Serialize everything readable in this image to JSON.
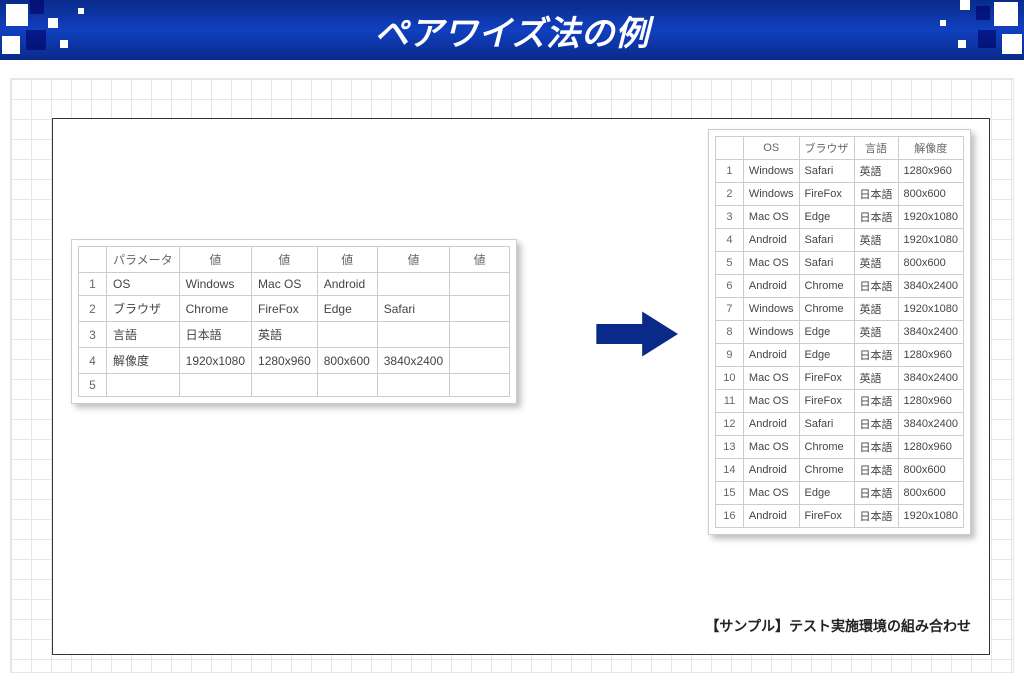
{
  "title": "ペアワイズ法の例",
  "caption": "【サンプル】テスト実施環境の組み合わせ",
  "input_table": {
    "headers": [
      "",
      "パラメータ",
      "値",
      "値",
      "値",
      "値",
      "値"
    ],
    "rows": [
      [
        "1",
        "OS",
        "Windows",
        "Mac OS",
        "Android",
        "",
        ""
      ],
      [
        "2",
        "ブラウザ",
        "Chrome",
        "FireFox",
        "Edge",
        "Safari",
        ""
      ],
      [
        "3",
        "言語",
        "日本語",
        "英語",
        "",
        "",
        ""
      ],
      [
        "4",
        "解像度",
        "1920x1080",
        "1280x960",
        "800x600",
        "3840x2400",
        ""
      ],
      [
        "5",
        "",
        "",
        "",
        "",
        "",
        ""
      ]
    ]
  },
  "output_table": {
    "headers": [
      "",
      "OS",
      "ブラウザ",
      "言語",
      "解像度"
    ],
    "rows": [
      [
        "1",
        "Windows",
        "Safari",
        "英語",
        "1280x960"
      ],
      [
        "2",
        "Windows",
        "FireFox",
        "日本語",
        "800x600"
      ],
      [
        "3",
        "Mac OS",
        "Edge",
        "日本語",
        "1920x1080"
      ],
      [
        "4",
        "Android",
        "Safari",
        "英語",
        "1920x1080"
      ],
      [
        "5",
        "Mac OS",
        "Safari",
        "英語",
        "800x600"
      ],
      [
        "6",
        "Android",
        "Chrome",
        "日本語",
        "3840x2400"
      ],
      [
        "7",
        "Windows",
        "Chrome",
        "英語",
        "1920x1080"
      ],
      [
        "8",
        "Windows",
        "Edge",
        "英語",
        "3840x2400"
      ],
      [
        "9",
        "Android",
        "Edge",
        "日本語",
        "1280x960"
      ],
      [
        "10",
        "Mac OS",
        "FireFox",
        "英語",
        "3840x2400"
      ],
      [
        "11",
        "Mac OS",
        "FireFox",
        "日本語",
        "1280x960"
      ],
      [
        "12",
        "Android",
        "Safari",
        "日本語",
        "3840x2400"
      ],
      [
        "13",
        "Mac OS",
        "Chrome",
        "日本語",
        "1280x960"
      ],
      [
        "14",
        "Android",
        "Chrome",
        "日本語",
        "800x600"
      ],
      [
        "15",
        "Mac OS",
        "Edge",
        "日本語",
        "800x600"
      ],
      [
        "16",
        "Android",
        "FireFox",
        "日本語",
        "1920x1080"
      ]
    ]
  }
}
